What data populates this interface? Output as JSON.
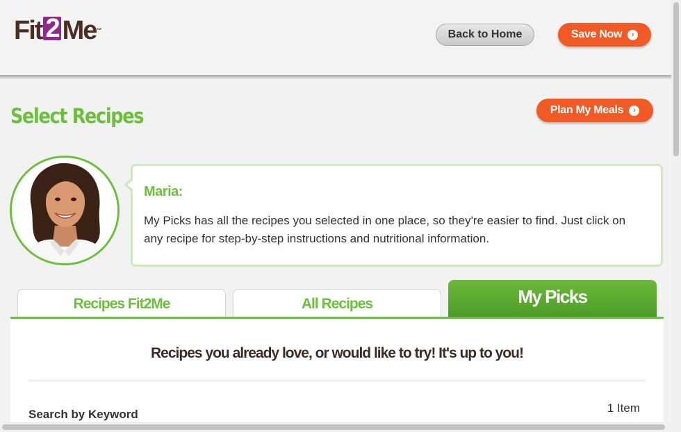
{
  "header": {
    "logo": {
      "part1": "Fit",
      "part2": "2",
      "part3": "Me",
      "tm": "™"
    },
    "back_label": "Back to Home",
    "save_label": "Save Now"
  },
  "page": {
    "title": "Select Recipes",
    "plan_label": "Plan My Meals"
  },
  "coach": {
    "name": "Maria:",
    "message": "My Picks has all the recipes you selected in one place, so they're easier to find. Just click on any recipe for step-by-step instructions and nutritional information."
  },
  "tabs": [
    {
      "label": "Recipes Fit2Me",
      "active": false
    },
    {
      "label": "All Recipes",
      "active": false
    },
    {
      "label": "My Picks",
      "active": true
    }
  ],
  "panel": {
    "heading": "Recipes you already love, or would like to try! It's up to you!",
    "search_label": "Search by Keyword",
    "item_count": "1 Item"
  },
  "colors": {
    "brand_green": "#6bbf3a",
    "accent_orange": "#f15a24",
    "logo_purple": "#8d2a8b",
    "logo_brown": "#4a2e22"
  },
  "icons": {
    "save_arrow": "chevron-circle-right-icon",
    "plan_arrow": "chevron-circle-right-icon"
  }
}
